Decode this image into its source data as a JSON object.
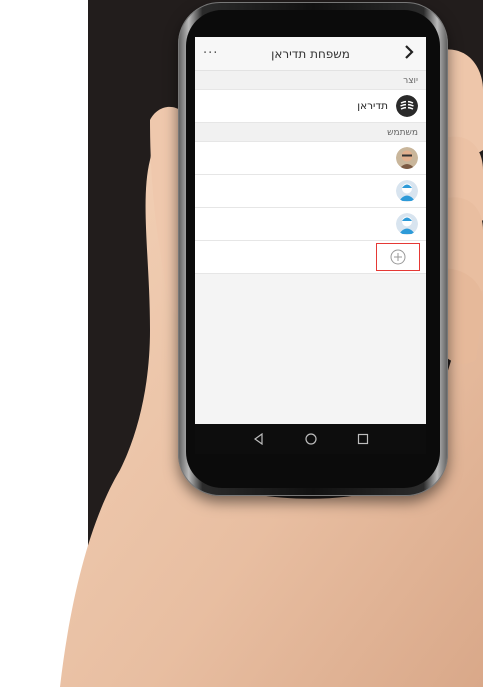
{
  "header": {
    "title": "משפחת תדיראן",
    "back_icon": "chevron-right-icon",
    "more_label": "···"
  },
  "sections": {
    "creator": {
      "label": "יוצר",
      "members": [
        {
          "name": "תדיראן",
          "avatar": "tadiran-logo"
        }
      ]
    },
    "users": {
      "label": "משתמש",
      "members": [
        {
          "name": "",
          "avatar": "photo-avatar"
        },
        {
          "name": "",
          "avatar": "default-avatar"
        },
        {
          "name": "",
          "avatar": "default-avatar"
        }
      ]
    }
  },
  "add_member": {
    "icon": "plus-circle-icon",
    "highlight_color": "#e53935"
  },
  "system_nav": {
    "buttons": [
      "back-triangle-icon",
      "home-circle-icon",
      "recents-square-icon"
    ]
  }
}
